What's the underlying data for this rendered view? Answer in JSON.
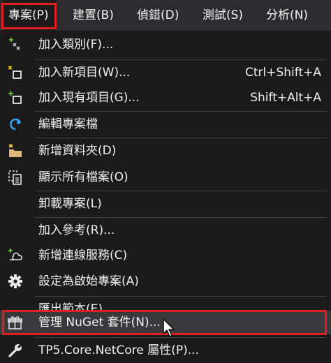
{
  "menubar": {
    "items": [
      {
        "label": "專案(P)"
      },
      {
        "label": "建置(B)"
      },
      {
        "label": "偵錯(D)"
      },
      {
        "label": "測試(S)"
      },
      {
        "label": "分析(N)"
      }
    ]
  },
  "menu": {
    "items": [
      {
        "label": "加入類別(F)...",
        "shortcut": "",
        "icon": "add-class-icon"
      },
      {
        "label": "加入新項目(W)...",
        "shortcut": "Ctrl+Shift+A",
        "icon": "add-new-item-icon"
      },
      {
        "label": "加入現有項目(G)...",
        "shortcut": "Shift+Alt+A",
        "icon": "add-existing-item-icon"
      },
      {
        "label": "編輯專案檔",
        "shortcut": "",
        "icon": "edit-project-icon"
      },
      {
        "label": "新增資料夾(D)",
        "shortcut": "",
        "icon": "new-folder-icon"
      },
      {
        "label": "顯示所有檔案(O)",
        "shortcut": "",
        "icon": "show-all-files-icon"
      },
      {
        "label": "卸載專案(L)",
        "shortcut": "",
        "icon": ""
      },
      {
        "label": "加入參考(R)...",
        "shortcut": "",
        "icon": ""
      },
      {
        "label": "新增連線服務(C)",
        "shortcut": "",
        "icon": "connected-service-icon"
      },
      {
        "label": "設定為啟始專案(A)",
        "shortcut": "",
        "icon": "gear-icon"
      },
      {
        "label": "匯出範本(E)...",
        "shortcut": "",
        "icon": ""
      },
      {
        "label": "管理 NuGet 套件(N)...",
        "shortcut": "",
        "icon": "nuget-package-icon"
      },
      {
        "label": "TP5.Core.NetCore 屬性(P)...",
        "shortcut": "",
        "icon": "wrench-icon"
      }
    ]
  },
  "colors": {
    "menu_bg": "#1b1b1c",
    "menubar_bg": "#2d2d30",
    "highlight_border": "#e02020",
    "icon_green": "#5fb832",
    "icon_blue": "#3ea6ff",
    "icon_folder": "#dcb67a"
  }
}
